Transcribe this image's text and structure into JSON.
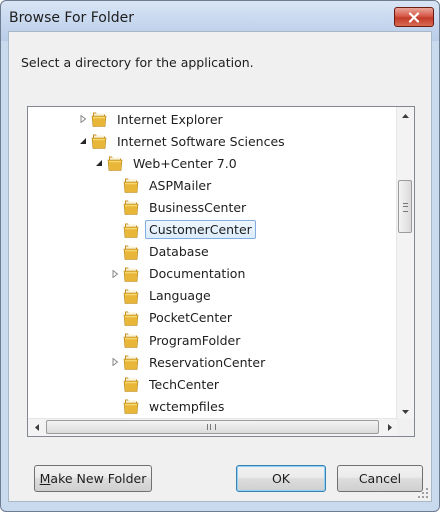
{
  "window": {
    "title": "Browse For Folder"
  },
  "instruction": "Select a directory for the application.",
  "tree": {
    "items": [
      {
        "label": "Internet Explorer",
        "level": 0,
        "expander": "collapsed",
        "selected": false
      },
      {
        "label": "Internet Software Sciences",
        "level": 0,
        "expander": "expanded",
        "selected": false
      },
      {
        "label": "Web+Center 7.0",
        "level": 1,
        "expander": "expanded",
        "selected": false
      },
      {
        "label": "ASPMailer",
        "level": 2,
        "expander": "none",
        "selected": false
      },
      {
        "label": "BusinessCenter",
        "level": 2,
        "expander": "none",
        "selected": false
      },
      {
        "label": "CustomerCenter",
        "level": 2,
        "expander": "none",
        "selected": true
      },
      {
        "label": "Database",
        "level": 2,
        "expander": "none",
        "selected": false
      },
      {
        "label": "Documentation",
        "level": 2,
        "expander": "collapsed",
        "selected": false
      },
      {
        "label": "Language",
        "level": 2,
        "expander": "none",
        "selected": false
      },
      {
        "label": "PocketCenter",
        "level": 2,
        "expander": "none",
        "selected": false
      },
      {
        "label": "ProgramFolder",
        "level": 2,
        "expander": "none",
        "selected": false
      },
      {
        "label": "ReservationCenter",
        "level": 2,
        "expander": "collapsed",
        "selected": false
      },
      {
        "label": "TechCenter",
        "level": 2,
        "expander": "none",
        "selected": false
      },
      {
        "label": "wctempfiles",
        "level": 2,
        "expander": "none",
        "selected": false
      }
    ]
  },
  "buttons": {
    "new_folder": {
      "prefix": "",
      "mnemonic": "M",
      "rest": "ake New Folder"
    },
    "ok": "OK",
    "cancel": "Cancel"
  },
  "icons": {
    "folder": "folder-icon",
    "close": "close-icon",
    "expanded": "expanded-triangle-icon",
    "collapsed": "collapsed-triangle-icon"
  },
  "colors": {
    "folder": "#e8b73a",
    "selection": "#dcecfc",
    "close": "#c83e2c"
  }
}
